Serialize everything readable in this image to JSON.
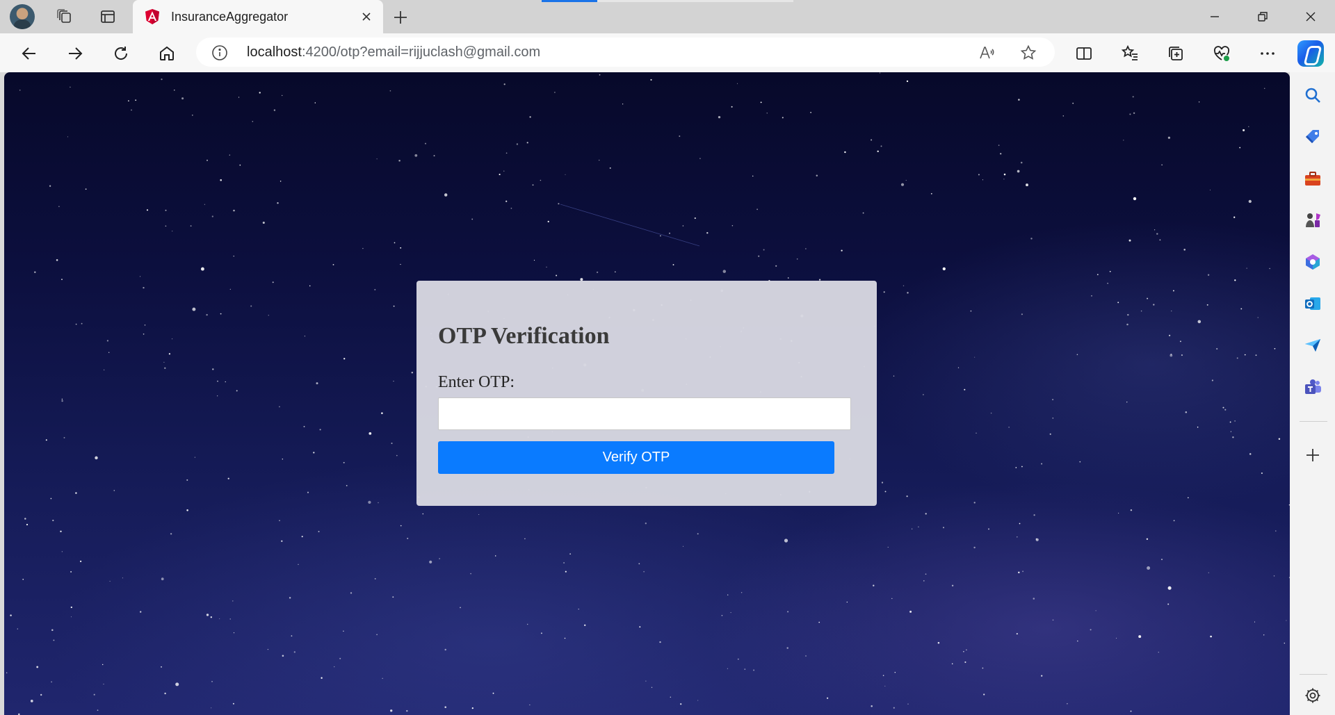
{
  "browser": {
    "tab": {
      "title": "InsuranceAggregator",
      "favicon": "angular-icon"
    },
    "load_progress": 0.22,
    "address": {
      "host": "localhost",
      "path": ":4200/otp?email=rijjuclash@gmail.com"
    },
    "icons": {
      "profile": "avatar",
      "workspaces": "workspaces-icon",
      "vertical_tabs": "tab-actions-icon",
      "back": "back-arrow-icon",
      "forward": "forward-arrow-icon",
      "refresh": "refresh-icon",
      "home": "home-icon",
      "site_info": "info-icon",
      "read_aloud": "read-aloud-icon",
      "favorite": "star-icon",
      "split_screen": "split-screen-icon",
      "favorites": "favorites-icon",
      "collections": "collections-icon",
      "browser_essentials": "heart-pulse-icon",
      "more": "more-dots-icon",
      "copilot": "copilot-icon"
    },
    "sidebar": [
      "search-icon",
      "shopping-tag-icon",
      "tools-icon",
      "games-icon",
      "m365-icon",
      "outlook-icon",
      "drop-icon",
      "teams-icon",
      "add-icon",
      "settings-icon"
    ],
    "accent": "#1a73e8"
  },
  "page": {
    "title": "OTP Verification",
    "otp_label": "Enter OTP:",
    "otp_value": "",
    "verify_button": "Verify OTP",
    "button_color": "#0a7bff"
  }
}
